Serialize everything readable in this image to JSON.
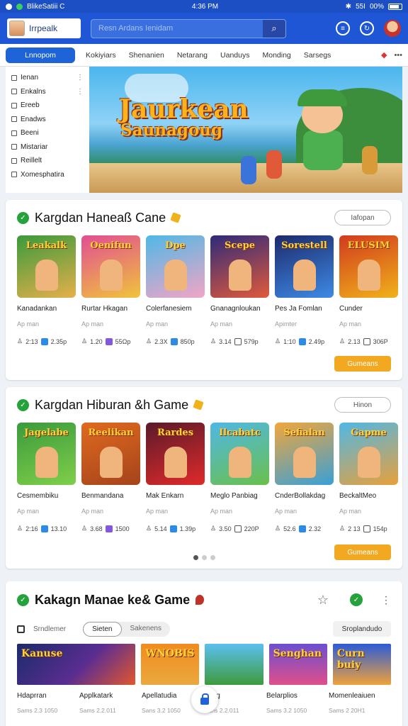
{
  "status": {
    "left": "BlikeSatiii C",
    "time": "4:36 PM",
    "signal": "55I",
    "battery": "00%"
  },
  "appbar": {
    "brand": "Irrpealk",
    "search_placeholder": "Resn Ardans Ienidam"
  },
  "tabs": [
    "Lnnopom",
    "Kokiyiars",
    "Shenanien",
    "Netarang",
    "Uanduys",
    "Monding",
    "Sarsegs"
  ],
  "sidemenu": [
    "Ienan",
    "Enkalns",
    "Ereeb",
    "Enadws",
    "Beeni",
    "Mistariar",
    "Reillelt",
    "Xomesphatira"
  ],
  "banner": {
    "line1": "Jaurkean",
    "line2": "Saunagoug"
  },
  "section1": {
    "title": "Kargdan Haneaß Cane",
    "pill": "Iafopan",
    "button": "Gumeans",
    "games": [
      {
        "thumb": "Leakalk",
        "name": "Kanadankan",
        "sub": "Ap man",
        "rating": "2:13",
        "count": "2.35p"
      },
      {
        "thumb": "Oenifun",
        "name": "Rurtar Hkagan",
        "sub": "Ap man",
        "rating": "1.20",
        "count": "55Ωp"
      },
      {
        "thumb": "Dpe",
        "name": "Colerfanesiem",
        "sub": "Ap man",
        "rating": "2.3X",
        "count": "850p"
      },
      {
        "thumb": "Scepe",
        "name": "Gnanagnloukan",
        "sub": "Ap man",
        "rating": "3.14",
        "count": "579p"
      },
      {
        "thumb": "Sorestell",
        "name": "Pes Ja Fomlan",
        "sub": "Apimter",
        "rating": "1:10",
        "count": "2.49p"
      },
      {
        "thumb": "ELUSIM",
        "name": "Cunder",
        "sub": "Ap man",
        "rating": "2.13",
        "count": "306P"
      }
    ]
  },
  "section2": {
    "title": "Kargdan Hiburan &h Game",
    "pill": "Hinon",
    "button": "Gumeans",
    "games": [
      {
        "thumb": "Jagelabe",
        "name": "Cesmembiku",
        "sub": "Ap man",
        "rating": "2:16",
        "count": "13.10"
      },
      {
        "thumb": "Reelikan",
        "name": "Benmandana",
        "sub": "Ap man",
        "rating": "3.68",
        "count": "1500"
      },
      {
        "thumb": "Rardes",
        "name": "Mak Enkarn",
        "sub": "Ap man",
        "rating": "5.14",
        "count": "1.39p"
      },
      {
        "thumb": "Ilcabatc",
        "name": "Meglo Panbiag",
        "sub": "Ap man",
        "rating": "3.50",
        "count": "220P"
      },
      {
        "thumb": "Sefialan",
        "name": "CnderBollakdag",
        "sub": "Ap man",
        "rating": "52.6",
        "count": "2.32"
      },
      {
        "thumb": "Gapme",
        "name": "BeckaltMeo",
        "sub": "Ap man",
        "rating": "2 13",
        "count": "154p"
      }
    ]
  },
  "section3": {
    "title": "Kakagn Manae ke& Game",
    "filter_label": "Srndlemer",
    "segments": [
      "Sieten",
      "Sakenens"
    ],
    "right_button": "Sroplandudo",
    "strip": [
      "Kanuse",
      "",
      "WNOBIS",
      "",
      "Senghan",
      "Curn buiy"
    ],
    "labels": [
      {
        "name": "Hdaprran",
        "sub": "Sams 2.3 1050"
      },
      {
        "name": "Applkatark",
        "sub": "Sams 2.2.011"
      },
      {
        "name": "Apellatudia",
        "sub": "Sans 3.2 1050"
      },
      {
        "name": "Fang",
        "sub": "Sans 2.2.011"
      },
      {
        "name": "Belarplios",
        "sub": "Sams 3.2 1050"
      },
      {
        "name": "Momenleaiuen",
        "sub": "Sams 2 20H1"
      }
    ]
  },
  "colors": {
    "primary": "#1e56d6",
    "accent": "#f2a820",
    "check": "#26a23c"
  }
}
